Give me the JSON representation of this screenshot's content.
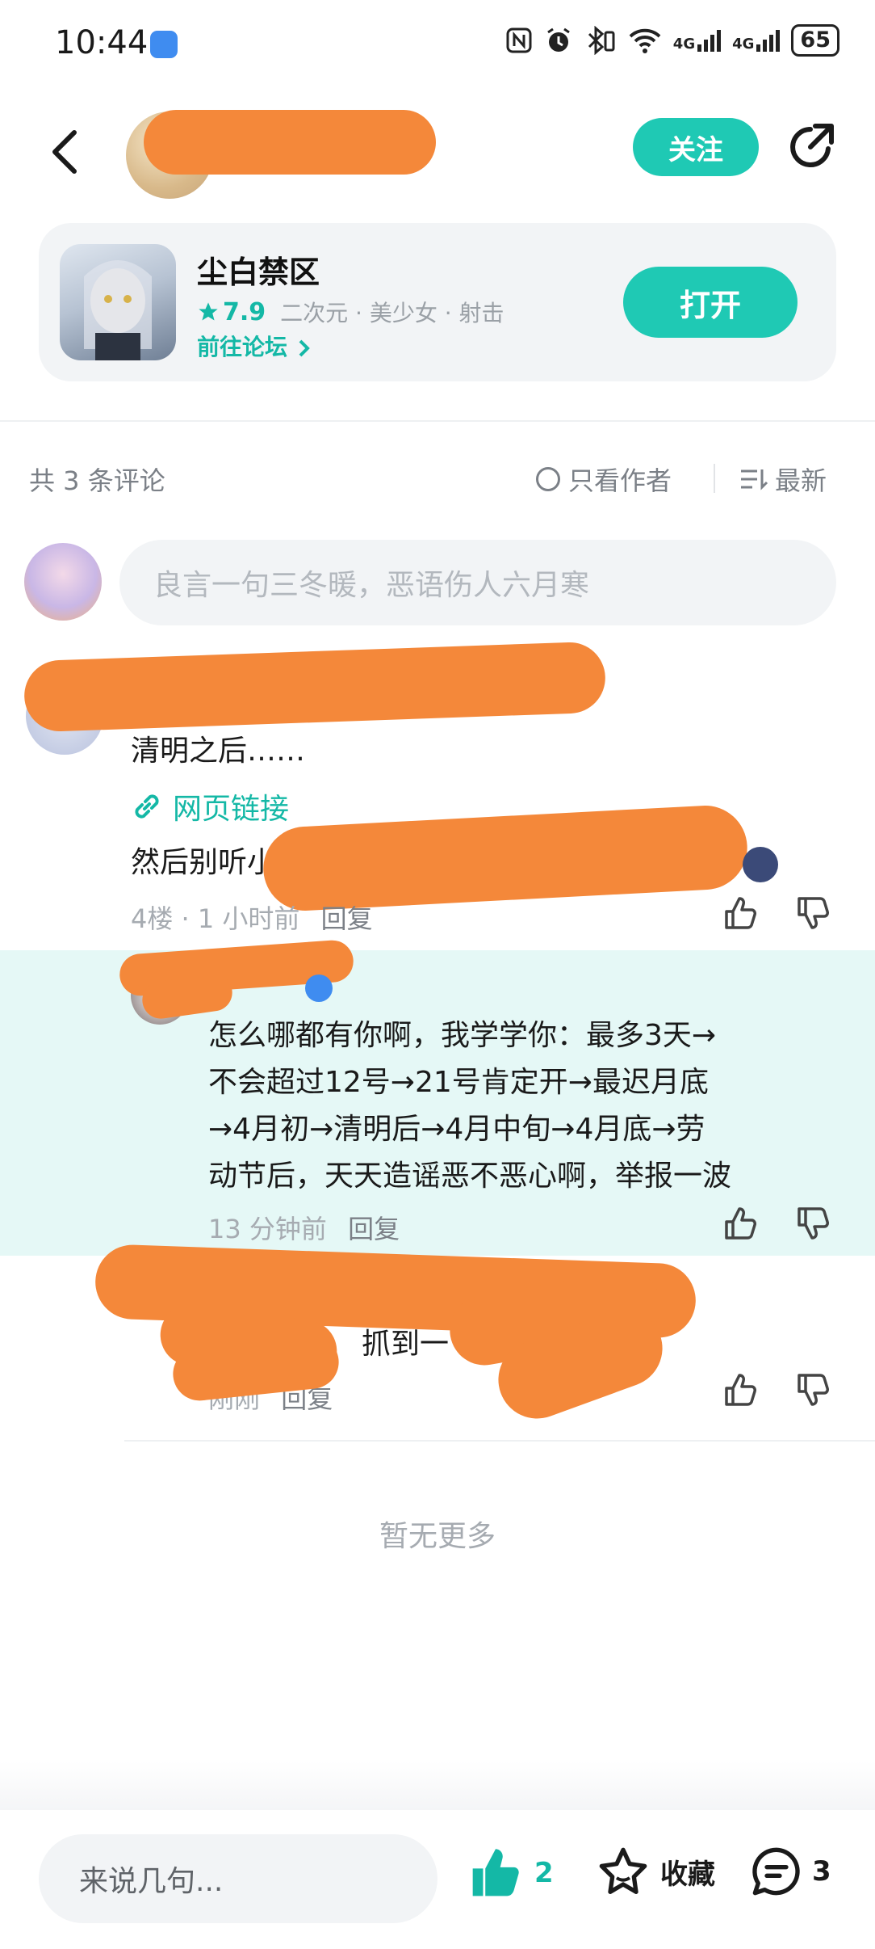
{
  "status_bar": {
    "time": "10:44",
    "icons": [
      "nfc-icon",
      "alarm-icon",
      "bluetooth-icon",
      "wifi-icon",
      "4g-signal-icon",
      "4g-signal-icon-2"
    ],
    "network_label_1": "4G",
    "network_label_2": "4G",
    "battery": "65"
  },
  "header": {
    "follow_label": "关注"
  },
  "game_card": {
    "title": "尘白禁区",
    "rating": "7.9",
    "tags": "二次元 · 美少女 · 射击",
    "forum_link": "前往论坛",
    "open_label": "打开"
  },
  "comments_bar": {
    "count_text": "共 3 条评论",
    "only_author": "只看作者",
    "sort": "最新"
  },
  "comment_input": {
    "placeholder": "良言一句三冬暖，恶语伤人六月寒"
  },
  "comments": [
    {
      "line1": "清明之后……",
      "link": "网页链接",
      "line2": "然后别听小",
      "meta": "4楼 · 1 小时前",
      "reply": "回复"
    },
    {
      "lines": [
        "怎么哪都有你啊，我学学你：最多3天→",
        "不会超过12号→21号肯定开→最迟月底",
        "→4月初→清明后→4月中旬→4月底→劳",
        "动节后，天天造谣恶不恶心啊，举报一波"
      ],
      "time": "13 分钟前",
      "reply": "回复"
    },
    {
      "text_tail": "抓到一",
      "time": "刚刚",
      "reply": "回复"
    }
  ],
  "no_more": "暂无更多",
  "bottom_bar": {
    "input_placeholder": "来说几句...",
    "like_count": "2",
    "favorite_label": "收藏",
    "comment_count": "3"
  },
  "colors": {
    "accent": "#1fc9b4",
    "accent_text": "#14b8a6",
    "redaction": "#f4883a",
    "highlight_bg": "#e5f8f6"
  }
}
